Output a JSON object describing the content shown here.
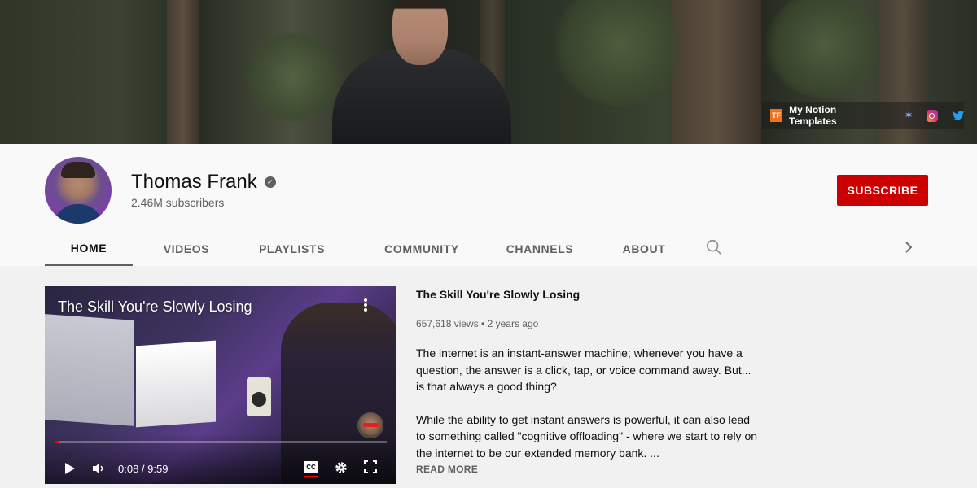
{
  "banner": {
    "links": {
      "logo_text": "TF",
      "label": "My Notion Templates",
      "extra_icons": [
        "star-icon",
        "instagram-icon",
        "twitter-icon"
      ]
    }
  },
  "channel": {
    "name": "Thomas Frank",
    "verified": true,
    "subscribers": "2.46M subscribers",
    "subscribe_label": "SUBSCRIBE"
  },
  "tabs": [
    {
      "label": "HOME",
      "active": true
    },
    {
      "label": "VIDEOS",
      "active": false
    },
    {
      "label": "PLAYLISTS",
      "active": false
    },
    {
      "label": "COMMUNITY",
      "active": false
    },
    {
      "label": "CHANNELS",
      "active": false
    },
    {
      "label": "ABOUT",
      "active": false
    }
  ],
  "featured": {
    "player": {
      "overlay_title": "The Skill You're Slowly Losing",
      "time": "0:08 / 9:59",
      "progress": 0.0134,
      "cc_label": "CC"
    },
    "title": "The Skill You're Slowly Losing",
    "meta": "657,618 views • 2 years ago",
    "description": [
      "The internet is an instant-answer machine; whenever you have a question, the answer is a click, tap, or voice command away. But... is that always a good thing?",
      "While the ability to get instant answers is powerful, it can also lead to something called \"cognitive offloading\" - where we start to rely on the internet to be our extended memory bank. ..."
    ],
    "read_more": "READ MORE"
  },
  "colors": {
    "subscribe": "#cc0000",
    "progress": "#ff0000",
    "accent_logo": "#f2711c"
  }
}
